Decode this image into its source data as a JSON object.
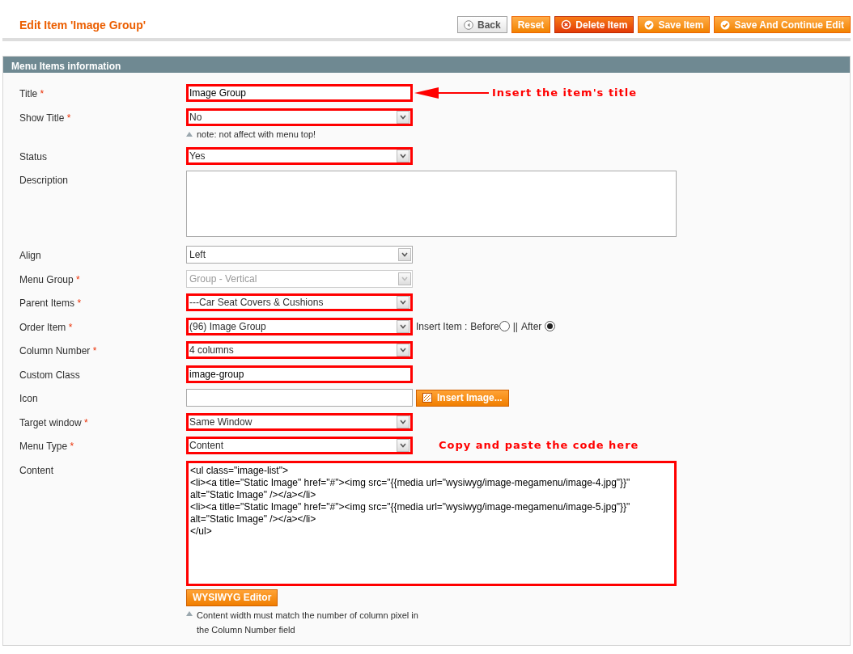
{
  "page_title": "Edit Item 'Image Group'",
  "buttons": [
    {
      "label": "Back",
      "kind": "back"
    },
    {
      "label": "Reset",
      "kind": "plain"
    },
    {
      "label": "Delete Item",
      "kind": "delete"
    },
    {
      "label": "Save Item",
      "kind": "save"
    },
    {
      "label": "Save And Continue Edit",
      "kind": "save"
    }
  ],
  "section_title": "Menu Items information",
  "rows": [
    {
      "label": "Title",
      "required_marker": "*",
      "kind": "text",
      "value": "Image Group",
      "highlighted": true,
      "annotation": {
        "text": "Insert the item's title",
        "arrow": true
      }
    },
    {
      "label": "Show Title",
      "required_marker": "*",
      "kind": "select",
      "value": "No",
      "highlighted": true,
      "note": "note: not affect with menu top!"
    },
    {
      "label": "Status",
      "kind": "select",
      "value": "Yes",
      "highlighted": true
    },
    {
      "label": "Description",
      "kind": "textarea",
      "highlighted": false
    },
    {
      "label": "Align",
      "kind": "select",
      "value": "Left",
      "highlighted": false
    },
    {
      "label": "Menu Group",
      "required_marker": "*",
      "kind": "select",
      "value": "Group - Vertical",
      "highlighted": false,
      "disabled": true
    },
    {
      "label": "Parent Items",
      "required_marker": "*",
      "kind": "select",
      "value": "---Car Seat Covers & Cushions",
      "highlighted": true
    },
    {
      "label": "Order Item",
      "required_marker": "*",
      "kind": "select",
      "value": "(96) Image Group",
      "highlighted": true,
      "insert_label": "Insert Item :",
      "separator": "||",
      "radios": [
        {
          "label": "Before",
          "selected": false
        },
        {
          "label": "After",
          "selected": true
        }
      ]
    },
    {
      "label": "Column Number",
      "required_marker": "*",
      "kind": "select",
      "value": "4 columns",
      "highlighted": true
    },
    {
      "label": "Custom Class",
      "kind": "text",
      "value": "image-group",
      "highlighted": true
    },
    {
      "label": "Icon",
      "kind": "image",
      "highlighted": false,
      "button": "Insert Image..."
    },
    {
      "label": "Target window",
      "required_marker": "*",
      "kind": "select",
      "value": "Same Window",
      "highlighted": true
    },
    {
      "label": "Menu Type",
      "required_marker": "*",
      "kind": "select",
      "value": "Content",
      "highlighted": true,
      "annotation": {
        "text": "Copy and paste the code here",
        "arrow": false
      }
    },
    {
      "label": "Content",
      "kind": "editor",
      "highlighted": true,
      "value": "<ul class=\"image-list\">\n<li><a title=\"Static Image\" href=\"#\"><img src=\"{{media url=\"wysiwyg/image-megamenu/image-4.jpg\"}}\"\nalt=\"Static Image\" /></a></li>\n<li><a title=\"Static Image\" href=\"#\"><img src=\"{{media url=\"wysiwyg/image-megamenu/image-5.jpg\"}}\"\nalt=\"Static Image\" /></a></li>\n</ul>",
      "button": "WYSIWYG Editor",
      "note_lines": [
        "Content width must match the number of column pixel in",
        "the Column Number field"
      ]
    }
  ]
}
